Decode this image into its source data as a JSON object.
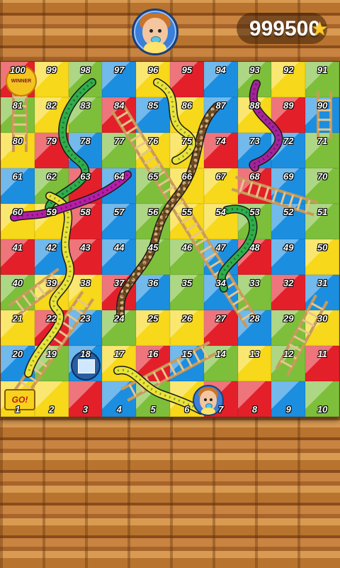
{
  "score": {
    "value": "999500",
    "icon": "star-icon"
  },
  "player": {
    "avatar": "baby-boy-avatar"
  },
  "board": {
    "colors": {
      "red": "#e3202a",
      "yellow": "#f7d81a",
      "green": "#7dbf3a",
      "blue": "#1c8ee0"
    },
    "rows": [
      [
        {
          "n": "100",
          "c": "red"
        },
        {
          "n": "99",
          "c": "yellow"
        },
        {
          "n": "98",
          "c": "green"
        },
        {
          "n": "97",
          "c": "blue"
        },
        {
          "n": "96",
          "c": "yellow"
        },
        {
          "n": "95",
          "c": "red"
        },
        {
          "n": "94",
          "c": "blue"
        },
        {
          "n": "93",
          "c": "green"
        },
        {
          "n": "92",
          "c": "yellow"
        },
        {
          "n": "91",
          "c": "green"
        }
      ],
      [
        {
          "n": "81",
          "c": "green"
        },
        {
          "n": "82",
          "c": "yellow"
        },
        {
          "n": "83",
          "c": "green"
        },
        {
          "n": "84",
          "c": "red"
        },
        {
          "n": "85",
          "c": "blue"
        },
        {
          "n": "86",
          "c": "yellow"
        },
        {
          "n": "87",
          "c": "blue"
        },
        {
          "n": "88",
          "c": "yellow"
        },
        {
          "n": "89",
          "c": "red"
        },
        {
          "n": "90",
          "c": "blue"
        }
      ],
      [
        {
          "n": "80",
          "c": "yellow"
        },
        {
          "n": "79",
          "c": "red"
        },
        {
          "n": "78",
          "c": "blue"
        },
        {
          "n": "77",
          "c": "green"
        },
        {
          "n": "76",
          "c": "yellow"
        },
        {
          "n": "75",
          "c": "yellow"
        },
        {
          "n": "74",
          "c": "red"
        },
        {
          "n": "73",
          "c": "blue"
        },
        {
          "n": "72",
          "c": "blue"
        },
        {
          "n": "71",
          "c": "green"
        }
      ],
      [
        {
          "n": "61",
          "c": "blue"
        },
        {
          "n": "62",
          "c": "green"
        },
        {
          "n": "63",
          "c": "red"
        },
        {
          "n": "64",
          "c": "blue"
        },
        {
          "n": "65",
          "c": "green"
        },
        {
          "n": "66",
          "c": "yellow"
        },
        {
          "n": "67",
          "c": "yellow"
        },
        {
          "n": "68",
          "c": "red"
        },
        {
          "n": "69",
          "c": "blue"
        },
        {
          "n": "70",
          "c": "green"
        }
      ],
      [
        {
          "n": "60",
          "c": "yellow"
        },
        {
          "n": "59",
          "c": "yellow"
        },
        {
          "n": "58",
          "c": "red"
        },
        {
          "n": "57",
          "c": "blue"
        },
        {
          "n": "56",
          "c": "green"
        },
        {
          "n": "55",
          "c": "yellow"
        },
        {
          "n": "54",
          "c": "yellow"
        },
        {
          "n": "53",
          "c": "green"
        },
        {
          "n": "52",
          "c": "blue"
        },
        {
          "n": "51",
          "c": "green"
        }
      ],
      [
        {
          "n": "41",
          "c": "red"
        },
        {
          "n": "42",
          "c": "blue"
        },
        {
          "n": "43",
          "c": "red"
        },
        {
          "n": "44",
          "c": "blue"
        },
        {
          "n": "45",
          "c": "green"
        },
        {
          "n": "46",
          "c": "green"
        },
        {
          "n": "47",
          "c": "blue"
        },
        {
          "n": "48",
          "c": "red"
        },
        {
          "n": "49",
          "c": "blue"
        },
        {
          "n": "50",
          "c": "yellow"
        }
      ],
      [
        {
          "n": "40",
          "c": "green"
        },
        {
          "n": "39",
          "c": "yellow"
        },
        {
          "n": "38",
          "c": "yellow"
        },
        {
          "n": "37",
          "c": "red"
        },
        {
          "n": "36",
          "c": "blue"
        },
        {
          "n": "35",
          "c": "green"
        },
        {
          "n": "34",
          "c": "blue"
        },
        {
          "n": "33",
          "c": "green"
        },
        {
          "n": "32",
          "c": "red"
        },
        {
          "n": "31",
          "c": "blue"
        }
      ],
      [
        {
          "n": "21",
          "c": "yellow"
        },
        {
          "n": "22",
          "c": "red"
        },
        {
          "n": "23",
          "c": "blue"
        },
        {
          "n": "24",
          "c": "green"
        },
        {
          "n": "25",
          "c": "yellow"
        },
        {
          "n": "26",
          "c": "yellow"
        },
        {
          "n": "27",
          "c": "red"
        },
        {
          "n": "28",
          "c": "blue"
        },
        {
          "n": "29",
          "c": "green"
        },
        {
          "n": "30",
          "c": "yellow"
        }
      ],
      [
        {
          "n": "20",
          "c": "blue"
        },
        {
          "n": "19",
          "c": "green"
        },
        {
          "n": "18",
          "c": "blue"
        },
        {
          "n": "17",
          "c": "yellow"
        },
        {
          "n": "16",
          "c": "red"
        },
        {
          "n": "15",
          "c": "blue"
        },
        {
          "n": "14",
          "c": "green"
        },
        {
          "n": "13",
          "c": "yellow"
        },
        {
          "n": "12",
          "c": "green"
        },
        {
          "n": "11",
          "c": "red"
        }
      ],
      [
        {
          "n": "1",
          "c": "yellow"
        },
        {
          "n": "2",
          "c": "yellow"
        },
        {
          "n": "3",
          "c": "red"
        },
        {
          "n": "4",
          "c": "blue"
        },
        {
          "n": "5",
          "c": "green"
        },
        {
          "n": "6",
          "c": "yellow"
        },
        {
          "n": "7",
          "c": "red"
        },
        {
          "n": "8",
          "c": "red"
        },
        {
          "n": "9",
          "c": "blue"
        },
        {
          "n": "10",
          "c": "green"
        }
      ]
    ]
  },
  "labels": {
    "winner": "WINNER",
    "go": "GO!"
  },
  "snakes": [
    {
      "name": "green-snake",
      "color": "#2fae4a"
    },
    {
      "name": "yellow-snake-left",
      "color": "#e8e43a"
    },
    {
      "name": "purple-snake-right",
      "color": "#a4239a"
    },
    {
      "name": "purple-snake-mid",
      "color": "#b51ea8"
    },
    {
      "name": "brown-patterned-snake",
      "color": "#8a5a2a"
    },
    {
      "name": "yellow-snake-top",
      "color": "#e8e43a"
    },
    {
      "name": "yellow-snake-bottom",
      "color": "#e8e43a"
    },
    {
      "name": "green-snake-right",
      "color": "#2fae4a"
    }
  ],
  "ladders": [
    {
      "name": "ladder-top-left"
    },
    {
      "name": "ladder-top-right"
    },
    {
      "name": "ladder-long-diagonal"
    },
    {
      "name": "ladder-right-mid"
    },
    {
      "name": "ladder-left-lower"
    },
    {
      "name": "ladder-right-lower"
    },
    {
      "name": "ladder-bottom-center"
    },
    {
      "name": "ladder-bottom-left"
    }
  ]
}
